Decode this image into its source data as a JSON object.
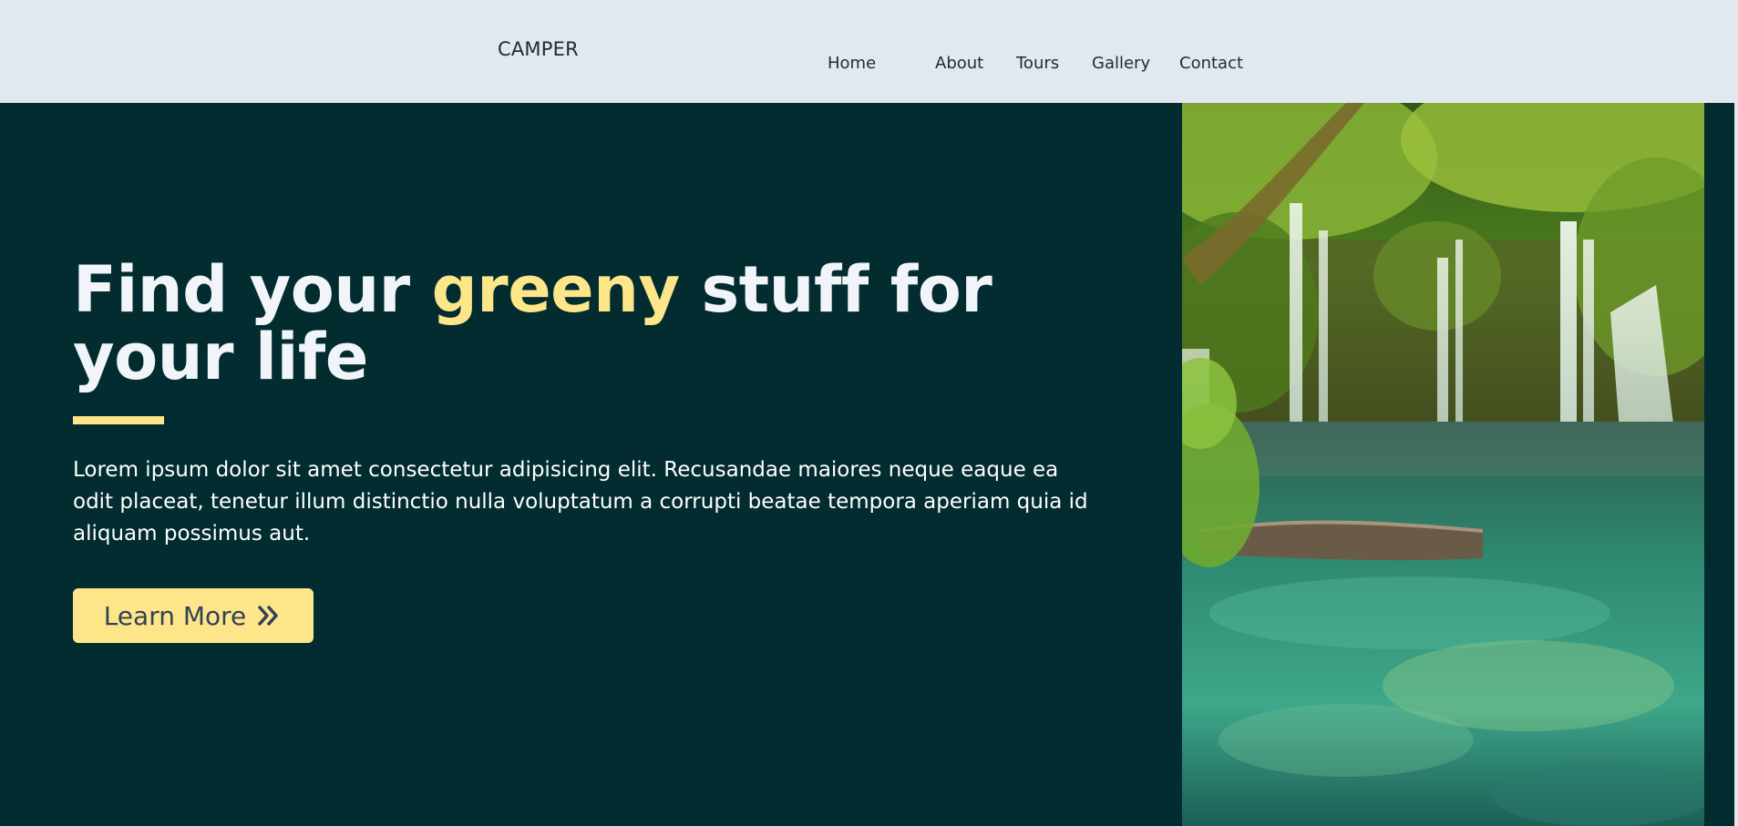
{
  "brand": "CAMPER",
  "nav": {
    "home": "Home",
    "about": "About",
    "tours": "Tours",
    "gallery": "Gallery",
    "contact": "Contact"
  },
  "hero": {
    "title_before": "Find your ",
    "title_accent": "greeny",
    "title_after": " stuff for your life",
    "description": "Lorem ipsum dolor sit amet consectetur adipisicing elit. Recusandae maiores neque eaque ea odit placeat, tenetur illum distinctio nulla voluptatum a corrupti beatae tempora aperiam quia id aliquam possimus aut.",
    "cta_label": "Learn More",
    "cta_icon": "double-chevron-right-icon"
  },
  "colors": {
    "background": "#022c2f",
    "navbar": "#e2e8f0",
    "accent": "#fde68a",
    "heading": "#f1f5f9"
  },
  "image": {
    "subject": "waterfall-lagoon"
  }
}
